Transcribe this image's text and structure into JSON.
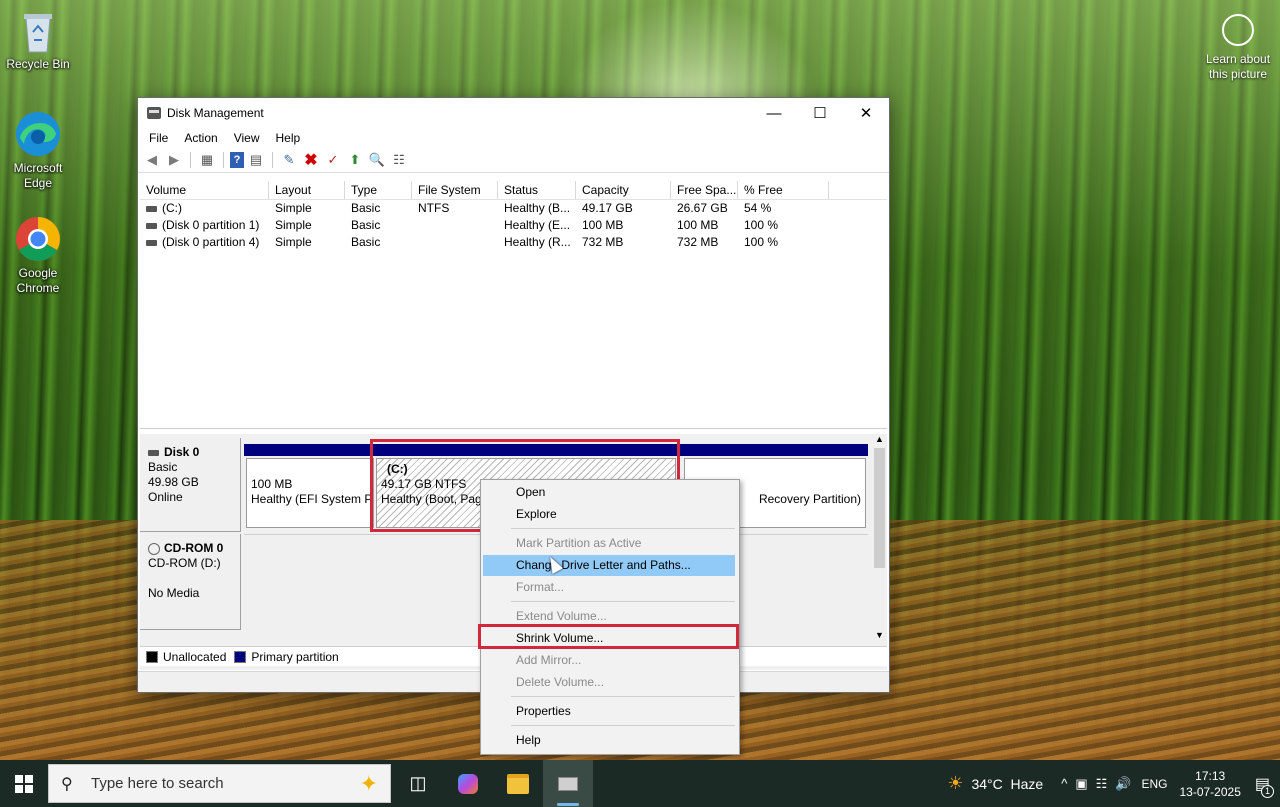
{
  "desktop": {
    "icons": [
      {
        "label": "Recycle Bin",
        "icon": "recycle-bin-icon"
      },
      {
        "label": "Microsoft Edge",
        "icon": "edge-icon"
      },
      {
        "label": "Google Chrome",
        "icon": "chrome-icon"
      }
    ],
    "learn_about": "Learn about this picture"
  },
  "window": {
    "title": "Disk Management",
    "menu": [
      "File",
      "Action",
      "View",
      "Help"
    ],
    "columns": [
      "Volume",
      "Layout",
      "Type",
      "File System",
      "Status",
      "Capacity",
      "Free Spa...",
      "% Free"
    ],
    "volumes": [
      {
        "volume": "(C:)",
        "layout": "Simple",
        "type": "Basic",
        "fs": "NTFS",
        "status": "Healthy (B...",
        "capacity": "49.17 GB",
        "free": "26.67 GB",
        "pct": "54 %"
      },
      {
        "volume": "(Disk 0 partition 1)",
        "layout": "Simple",
        "type": "Basic",
        "fs": "",
        "status": "Healthy (E...",
        "capacity": "100 MB",
        "free": "100 MB",
        "pct": "100 %"
      },
      {
        "volume": "(Disk 0 partition 4)",
        "layout": "Simple",
        "type": "Basic",
        "fs": "",
        "status": "Healthy (R...",
        "capacity": "732 MB",
        "free": "732 MB",
        "pct": "100 %"
      }
    ],
    "disk0": {
      "name": "Disk 0",
      "type": "Basic",
      "size": "49.98 GB",
      "state": "Online"
    },
    "partitions": {
      "efi": {
        "size": "100 MB",
        "status": "Healthy (EFI System P"
      },
      "c": {
        "label": "(C:)",
        "size": "49.17 GB NTFS",
        "status": "Healthy (Boot, Pag"
      },
      "recovery": {
        "status": "Recovery Partition)"
      }
    },
    "cdrom": {
      "name": "CD-ROM 0",
      "drive": "CD-ROM (D:)",
      "media": "No Media"
    },
    "legend": {
      "unallocated": "Unallocated",
      "primary": "Primary partition"
    },
    "legend_colors": {
      "unallocated": "#000000",
      "primary": "#00007f"
    }
  },
  "context_menu": {
    "open": "Open",
    "explore": "Explore",
    "mark_active": "Mark Partition as Active",
    "change_letter": "Change Drive Letter and Paths...",
    "format": "Format...",
    "extend": "Extend Volume...",
    "shrink": "Shrink Volume...",
    "add_mirror": "Add Mirror...",
    "delete": "Delete Volume...",
    "properties": "Properties",
    "help": "Help"
  },
  "taskbar": {
    "search_placeholder": "Type here to search",
    "weather": "34°C  Haze",
    "language": "ENG",
    "time": "17:13",
    "date": "13-07-2025",
    "notification_count": "1"
  },
  "colors": {
    "highlight": "#91c9f7",
    "annotation": "#d1283c",
    "primary_partition": "#00007f"
  }
}
